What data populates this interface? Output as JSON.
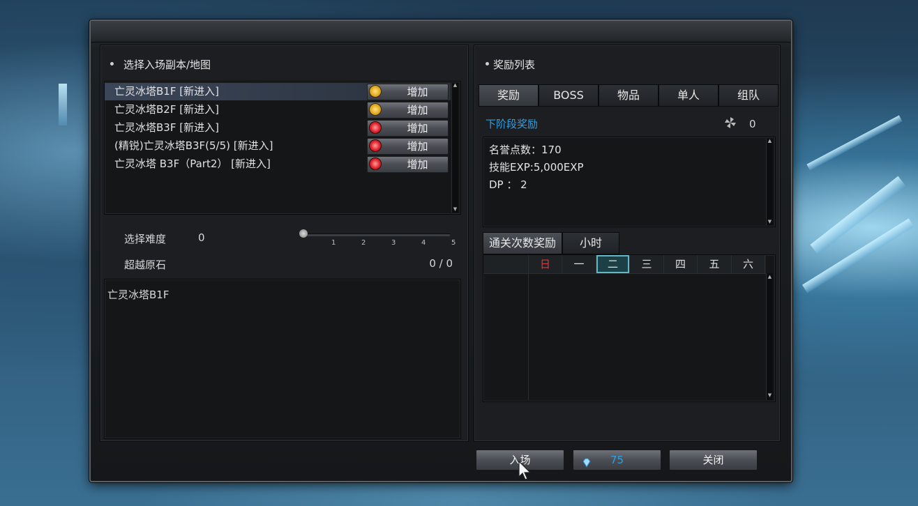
{
  "left_header": "选择入场副本/地图",
  "dungeons": [
    {
      "name": "亡灵冰塔B1F [新进入]",
      "button": "增加",
      "icon": "clock-icon-yellow"
    },
    {
      "name": "亡灵冰塔B2F [新进入]",
      "button": "增加",
      "icon": "clock-icon-yellow"
    },
    {
      "name": "亡灵冰塔B3F [新进入]",
      "button": "增加",
      "icon": "alarm-icon-red"
    },
    {
      "name": "(精锐)亡灵冰塔B3F(5/5) [新进入]",
      "button": "增加",
      "icon": "alarm-icon-red"
    },
    {
      "name": "亡灵冰塔  B3F（Part2） [新进入]",
      "button": "增加",
      "icon": "alarm-icon-red"
    }
  ],
  "difficulty": {
    "label": "选择难度",
    "value": "0",
    "ticks": [
      "0",
      "1",
      "2",
      "3",
      "4",
      "5"
    ],
    "level": 0
  },
  "stone": {
    "label": "超越原石",
    "value": "0 / 0"
  },
  "description_title": "亡灵冰塔B1F",
  "right_header": "奖励列表",
  "reward_tabs": [
    "奖励",
    "BOSS",
    "物品",
    "单人",
    "组队"
  ],
  "next_stage_label": "下阶段奖励",
  "next_stage_count": "0",
  "rewards": [
    "名誉点数：170",
    "技能EXP:5,000EXP",
    "DP ： 2"
  ],
  "schedule_tabs": [
    "通关次数奖励",
    "小时"
  ],
  "weekdays": [
    "日",
    "一",
    "二",
    "三",
    "四",
    "五",
    "六"
  ],
  "selected_weekday": "二",
  "buttons": {
    "enter": "入场",
    "gem_count": "75",
    "close": "关闭"
  },
  "colors": {
    "accent_blue": "#2f9fe0",
    "sunday_red": "#e23a3a",
    "selected_day": "#5fb8c8"
  }
}
